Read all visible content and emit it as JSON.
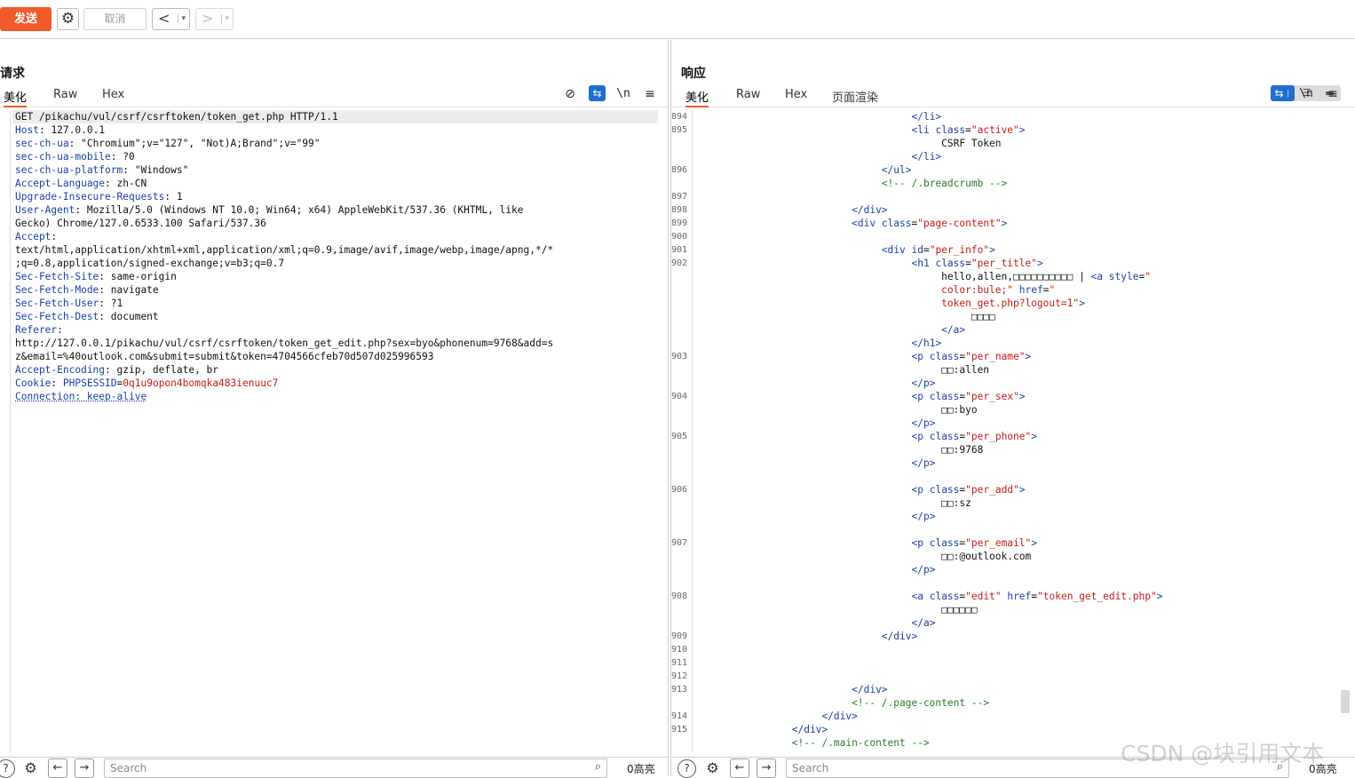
{
  "toolbar": {
    "send_label": "发送",
    "cancel_label": "取消",
    "back_glyph": "<",
    "forward_glyph": ">",
    "dropdown_glyph": "▾"
  },
  "request": {
    "title": "请求",
    "tabs": [
      "美化",
      "Raw",
      "Hex"
    ],
    "lines": [
      "GET /pikachu/vul/csrf/csrftoken/token_get.php HTTP/1.1",
      "Host: 127.0.0.1",
      "sec-ch-ua: \"Chromium\";v=\"127\", \"Not)A;Brand\";v=\"99\"",
      "sec-ch-ua-mobile: ?0",
      "sec-ch-ua-platform: \"Windows\"",
      "Accept-Language: zh-CN",
      "Upgrade-Insecure-Requests: 1",
      "User-Agent: Mozilla/5.0 (Windows NT 10.0; Win64; x64) AppleWebKit/537.36 (KHTML, like",
      "Gecko) Chrome/127.0.6533.100 Safari/537.36",
      "Accept:",
      "text/html,application/xhtml+xml,application/xml;q=0.9,image/avif,image/webp,image/apng,*/*",
      ";q=0.8,application/signed-exchange;v=b3;q=0.7",
      "Sec-Fetch-Site: same-origin",
      "Sec-Fetch-Mode: navigate",
      "Sec-Fetch-User: ?1",
      "Sec-Fetch-Dest: document",
      "Referer:",
      "http://127.0.0.1/pikachu/vul/csrf/csrftoken/token_get_edit.php?sex=byo&phonenum=9768&add=s",
      "z&email=%40outlook.com&submit=submit&token=470456 6cfeb70d507d025996593",
      "Accept-Encoding: gzip, deflate, br",
      "Cookie: PHPSESSID=0q1u9opon4bomqka483ienuuc7",
      "Connection: keep-alive"
    ],
    "search_placeholder": "Search",
    "highlight_count": "0高亮"
  },
  "response": {
    "title": "响应",
    "tabs": [
      "美化",
      "Raw",
      "Hex",
      "页面渲染"
    ],
    "line_numbers": [
      "894",
      "895",
      "",
      "",
      "896",
      "",
      "897",
      "898",
      "899",
      "900",
      "901",
      "902",
      "",
      "",
      "",
      "",
      "",
      "",
      "903",
      "",
      "",
      "904",
      "",
      "",
      "905",
      "",
      "",
      "",
      "906",
      "",
      "",
      "",
      "907",
      "",
      "",
      "",
      "908",
      "",
      "",
      "909",
      "910",
      "911",
      "912",
      "913",
      "",
      "914",
      "915"
    ],
    "search_placeholder": "Search",
    "highlight_count": "0高亮"
  },
  "watermark": "CSDN @块引用文本",
  "colors": {
    "accent": "#f15a2b",
    "blue": "#1f6fd1"
  }
}
